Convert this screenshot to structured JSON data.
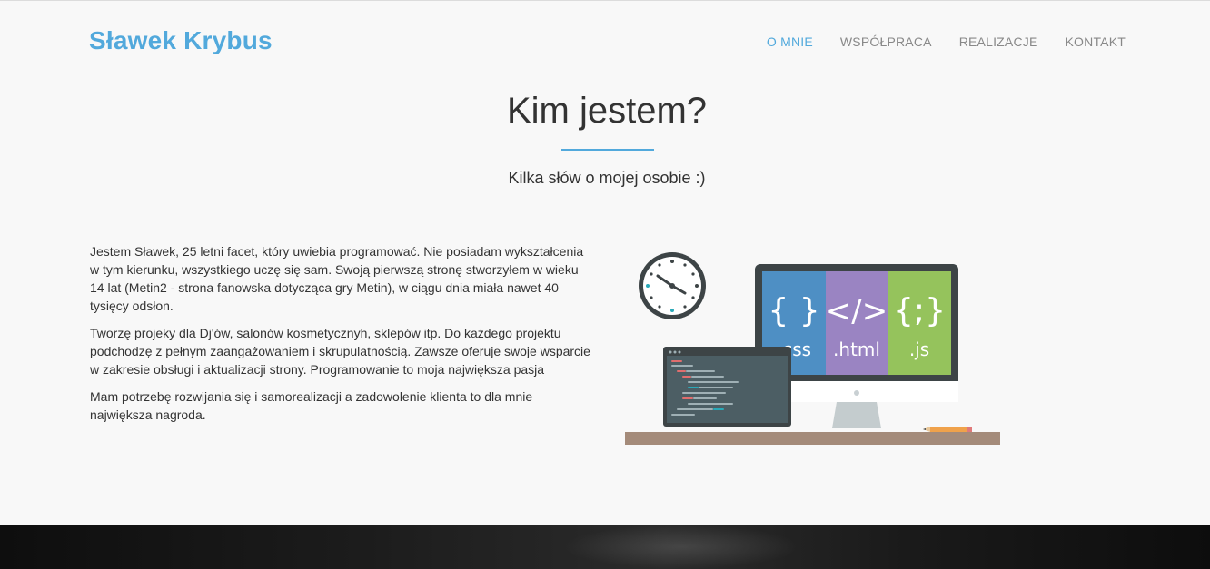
{
  "header": {
    "brand": "Sławek Krybus",
    "nav": [
      {
        "label": "O MNIE",
        "active": true
      },
      {
        "label": "WSPÓŁPRACA",
        "active": false
      },
      {
        "label": "REALIZACJE",
        "active": false
      },
      {
        "label": "KONTAKT",
        "active": false
      }
    ]
  },
  "section": {
    "title": "Kim jestem?",
    "subtitle": "Kilka słów o mojej osobie :)",
    "paragraphs": [
      "Jestem Sławek, 25 letni facet, który uwiebia programować. Nie posiadam wykształcenia w tym kierunku, wszystkiego uczę się sam. Swoją pierwszą stronę stworzyłem w wieku 14 lat (Metin2 - strona fanowska dotycząca gry Metin), w ciągu dnia miała nawet 40 tysięcy odsłon.",
      "Tworzę projeky dla Dj'ów, salonów kosmetycznyh, sklepów itp. Do każdego projektu podchodzę z pełnym zaangażowaniem i skrupulatnością. Zawsze oferuje swoje wsparcie w zakresie obsługi i aktualizacji strony. Programowanie to moja największa pasja",
      "Mam potrzebę rozwijania się i samorealizacji a zadowolenie klienta to dla mnie największa nagroda."
    ]
  },
  "illustration": {
    "panels": [
      {
        "glyph": "{ }",
        "label": ".css",
        "color": "#4e8fc4"
      },
      {
        "glyph": "</>",
        "label": ".html",
        "color": "#9a84c2"
      },
      {
        "glyph": "{;}",
        "label": ".js",
        "color": "#95c35c"
      }
    ],
    "icons": [
      "clock-icon",
      "laptop-icon",
      "monitor-icon",
      "pencil-icon"
    ]
  },
  "colors": {
    "accent": "#52a9dc",
    "nav_inactive": "#888888",
    "background": "#f8f8f8"
  }
}
